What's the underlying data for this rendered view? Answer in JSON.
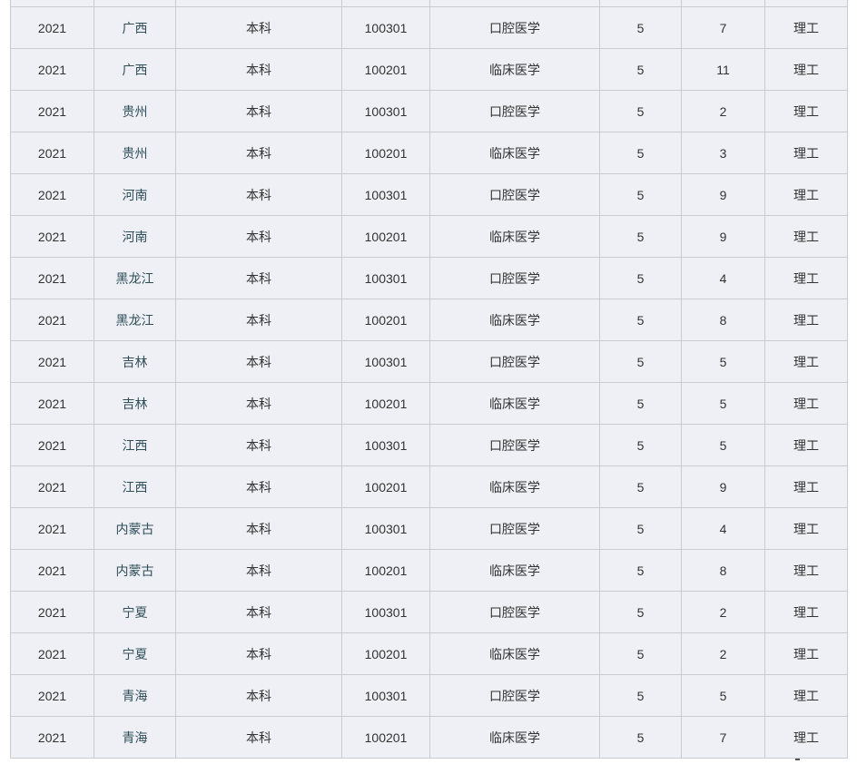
{
  "table": {
    "rows": [
      {
        "year": "2021",
        "province": "广西",
        "level": "本科",
        "code": "100301",
        "major": "口腔医学",
        "duration": "5",
        "count": "7",
        "category": "理工"
      },
      {
        "year": "2021",
        "province": "广西",
        "level": "本科",
        "code": "100201",
        "major": "临床医学",
        "duration": "5",
        "count": "11",
        "category": "理工"
      },
      {
        "year": "2021",
        "province": "贵州",
        "level": "本科",
        "code": "100301",
        "major": "口腔医学",
        "duration": "5",
        "count": "2",
        "category": "理工"
      },
      {
        "year": "2021",
        "province": "贵州",
        "level": "本科",
        "code": "100201",
        "major": "临床医学",
        "duration": "5",
        "count": "3",
        "category": "理工"
      },
      {
        "year": "2021",
        "province": "河南",
        "level": "本科",
        "code": "100301",
        "major": "口腔医学",
        "duration": "5",
        "count": "9",
        "category": "理工"
      },
      {
        "year": "2021",
        "province": "河南",
        "level": "本科",
        "code": "100201",
        "major": "临床医学",
        "duration": "5",
        "count": "9",
        "category": "理工"
      },
      {
        "year": "2021",
        "province": "黑龙江",
        "level": "本科",
        "code": "100301",
        "major": "口腔医学",
        "duration": "5",
        "count": "4",
        "category": "理工"
      },
      {
        "year": "2021",
        "province": "黑龙江",
        "level": "本科",
        "code": "100201",
        "major": "临床医学",
        "duration": "5",
        "count": "8",
        "category": "理工"
      },
      {
        "year": "2021",
        "province": "吉林",
        "level": "本科",
        "code": "100301",
        "major": "口腔医学",
        "duration": "5",
        "count": "5",
        "category": "理工"
      },
      {
        "year": "2021",
        "province": "吉林",
        "level": "本科",
        "code": "100201",
        "major": "临床医学",
        "duration": "5",
        "count": "5",
        "category": "理工"
      },
      {
        "year": "2021",
        "province": "江西",
        "level": "本科",
        "code": "100301",
        "major": "口腔医学",
        "duration": "5",
        "count": "5",
        "category": "理工"
      },
      {
        "year": "2021",
        "province": "江西",
        "level": "本科",
        "code": "100201",
        "major": "临床医学",
        "duration": "5",
        "count": "9",
        "category": "理工"
      },
      {
        "year": "2021",
        "province": "内蒙古",
        "level": "本科",
        "code": "100301",
        "major": "口腔医学",
        "duration": "5",
        "count": "4",
        "category": "理工"
      },
      {
        "year": "2021",
        "province": "内蒙古",
        "level": "本科",
        "code": "100201",
        "major": "临床医学",
        "duration": "5",
        "count": "8",
        "category": "理工"
      },
      {
        "year": "2021",
        "province": "宁夏",
        "level": "本科",
        "code": "100301",
        "major": "口腔医学",
        "duration": "5",
        "count": "2",
        "category": "理工"
      },
      {
        "year": "2021",
        "province": "宁夏",
        "level": "本科",
        "code": "100201",
        "major": "临床医学",
        "duration": "5",
        "count": "2",
        "category": "理工"
      },
      {
        "year": "2021",
        "province": "青海",
        "level": "本科",
        "code": "100301",
        "major": "口腔医学",
        "duration": "5",
        "count": "5",
        "category": "理工"
      },
      {
        "year": "2021",
        "province": "青海",
        "level": "本科",
        "code": "100201",
        "major": "临床医学",
        "duration": "5",
        "count": "7",
        "category": "理工"
      }
    ]
  }
}
